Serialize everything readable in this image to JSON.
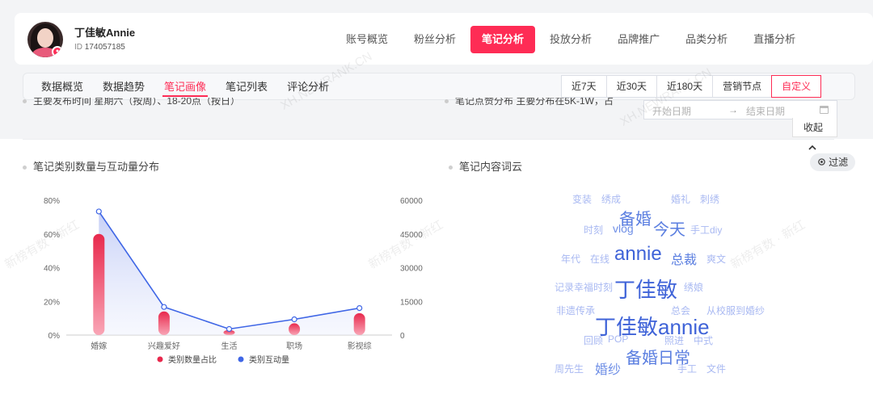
{
  "profile": {
    "name": "丁佳敏Annie",
    "id_label": "ID",
    "id_value": "174057185"
  },
  "main_nav": [
    {
      "label": "账号概览",
      "active": false
    },
    {
      "label": "粉丝分析",
      "active": false
    },
    {
      "label": "笔记分析",
      "active": true
    },
    {
      "label": "投放分析",
      "active": false
    },
    {
      "label": "品牌推广",
      "active": false
    },
    {
      "label": "品类分析",
      "active": false
    },
    {
      "label": "直播分析",
      "active": false
    }
  ],
  "sub_nav": [
    {
      "label": "数据概览",
      "active": false
    },
    {
      "label": "数据趋势",
      "active": false
    },
    {
      "label": "笔记画像",
      "active": true
    },
    {
      "label": "笔记列表",
      "active": false
    },
    {
      "label": "评论分析",
      "active": false
    }
  ],
  "date_range": [
    {
      "label": "近7天",
      "active": false
    },
    {
      "label": "近30天",
      "active": false
    },
    {
      "label": "近180天",
      "active": false
    },
    {
      "label": "营销节点",
      "active": false
    },
    {
      "label": "自定义",
      "active": true
    }
  ],
  "date_picker": {
    "start_placeholder": "开始日期",
    "arrow": "→",
    "end_placeholder": "结束日期"
  },
  "collapse_label": "收起",
  "peek": {
    "left": "主要发布时间      星期六（按周）、18-20点（按日）",
    "right": "笔记点赞分布      主要分布在5K-1W，占"
  },
  "section_left_title": "笔记类别数量与互动量分布",
  "section_right_title": "笔记内容词云",
  "filter_label": "过滤",
  "watermark": [
    "XH.NEWRANK.CN",
    "新榜有数 · 新红"
  ],
  "chart_data": {
    "type": "bar",
    "categories": [
      "婚嫁",
      "兴趣爱好",
      "生活",
      "职场",
      "影视综"
    ],
    "series": [
      {
        "name": "类别数量占比",
        "type": "bar",
        "axis": "left",
        "values": [
          60,
          14,
          3,
          7,
          13
        ],
        "color": "#e8294d"
      },
      {
        "name": "类别互动量",
        "type": "line",
        "axis": "right",
        "values": [
          55000,
          12500,
          2700,
          7000,
          12000
        ],
        "color": "#3f66e6"
      }
    ],
    "y_left": {
      "ticks": [
        "80%",
        "60%",
        "40%",
        "20%",
        "0%"
      ],
      "range": [
        0,
        80
      ]
    },
    "y_right": {
      "ticks": [
        "60000",
        "45000",
        "30000",
        "15000",
        "0"
      ],
      "range": [
        0,
        60000
      ]
    },
    "legend_position": "bottom"
  },
  "word_cloud": [
    {
      "text": "变装",
      "size": 12,
      "color": "#a9b9f2"
    },
    {
      "text": "绣成",
      "size": 12,
      "color": "#a9b9f2"
    },
    {
      "text": "婚礼",
      "size": 12,
      "color": "#a9b9f2"
    },
    {
      "text": "刺绣",
      "size": 12,
      "color": "#a9b9f2"
    },
    {
      "text": "备婚",
      "size": 20,
      "color": "#5a7ee0"
    },
    {
      "text": "时刻",
      "size": 12,
      "color": "#a9b9f2"
    },
    {
      "text": "vlog",
      "size": 14,
      "color": "#6f8fe6"
    },
    {
      "text": "今天",
      "size": 20,
      "color": "#5a7ee0"
    },
    {
      "text": "手工diy",
      "size": 12,
      "color": "#a9b9f2"
    },
    {
      "text": "年代",
      "size": 12,
      "color": "#a9b9f2"
    },
    {
      "text": "在线",
      "size": 12,
      "color": "#a9b9f2"
    },
    {
      "text": "annie",
      "size": 24,
      "color": "#3f63d8"
    },
    {
      "text": "总裁",
      "size": 16,
      "color": "#5a7ee0"
    },
    {
      "text": "爽文",
      "size": 12,
      "color": "#a9b9f2"
    },
    {
      "text": "记录幸福时刻",
      "size": 12,
      "color": "#a9b9f2"
    },
    {
      "text": "丁佳敏",
      "size": 26,
      "color": "#3f63d8"
    },
    {
      "text": "绣娘",
      "size": 12,
      "color": "#a9b9f2"
    },
    {
      "text": "非遗传承",
      "size": 12,
      "color": "#a9b9f2"
    },
    {
      "text": "总会",
      "size": 12,
      "color": "#a9b9f2"
    },
    {
      "text": "从校服到婚纱",
      "size": 12,
      "color": "#a9b9f2"
    },
    {
      "text": "丁佳敏annie",
      "size": 26,
      "color": "#3f63d8"
    },
    {
      "text": "回顾",
      "size": 12,
      "color": "#a9b9f2"
    },
    {
      "text": "POP",
      "size": 12,
      "color": "#a9b9f2"
    },
    {
      "text": "照进",
      "size": 12,
      "color": "#a9b9f2"
    },
    {
      "text": "中式",
      "size": 12,
      "color": "#a9b9f2"
    },
    {
      "text": "备婚日常",
      "size": 20,
      "color": "#5a7ee0"
    },
    {
      "text": "周先生",
      "size": 12,
      "color": "#a9b9f2"
    },
    {
      "text": "婚纱",
      "size": 16,
      "color": "#6f8fe6"
    },
    {
      "text": "手工",
      "size": 12,
      "color": "#a9b9f2"
    },
    {
      "text": "文件",
      "size": 12,
      "color": "#a9b9f2"
    }
  ]
}
